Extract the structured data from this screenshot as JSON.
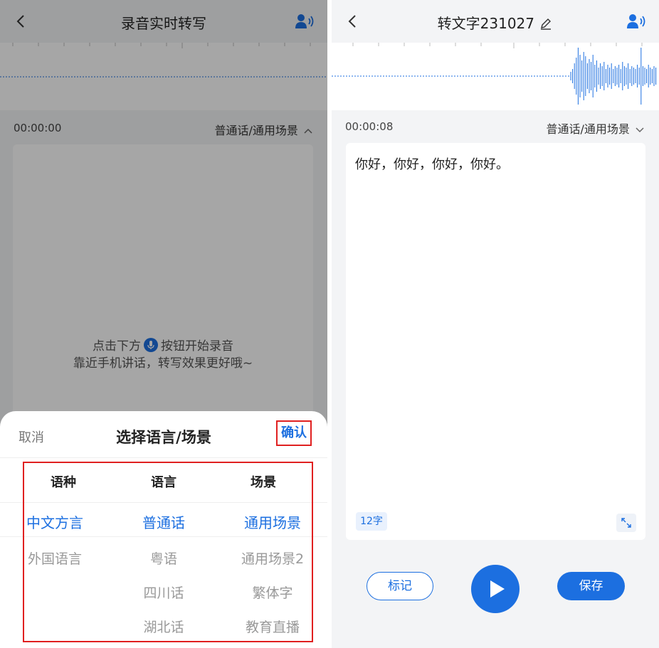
{
  "left": {
    "header_title": "录音实时转写",
    "time": "00:00:00",
    "language_scene": "普通话/通用场景",
    "hint_line1_a": "点击下方",
    "hint_line1_b": "按钮开始录音",
    "hint_line2": "靠近手机讲话，转写效果更好哦~",
    "sheet": {
      "cancel": "取消",
      "title": "选择语言/场景",
      "confirm": "确认",
      "col_type": "语种",
      "col_language": "语言",
      "col_scene": "场景",
      "types": [
        "中文方言",
        "外国语言"
      ],
      "languages": [
        "普通话",
        "粤语",
        "四川话",
        "湖北话"
      ],
      "scenes": [
        "通用场景",
        "通用场景2",
        "繁体字",
        "教育直播"
      ]
    }
  },
  "right": {
    "header_title": "转文字231027",
    "time": "00:00:08",
    "language_scene": "普通话/通用场景",
    "transcript": "你好，你好，你好，你好。",
    "char_count": "12字",
    "mark_button": "标记",
    "save_button": "保存"
  },
  "colors": {
    "accent": "#1c6fe0",
    "highlight_box": "#e02020"
  },
  "icons": [
    "back-arrow-icon",
    "speaker-icon",
    "chevron-up-icon",
    "chevron-down-icon",
    "edit-icon",
    "mic-icon",
    "play-icon",
    "expand-icon"
  ]
}
